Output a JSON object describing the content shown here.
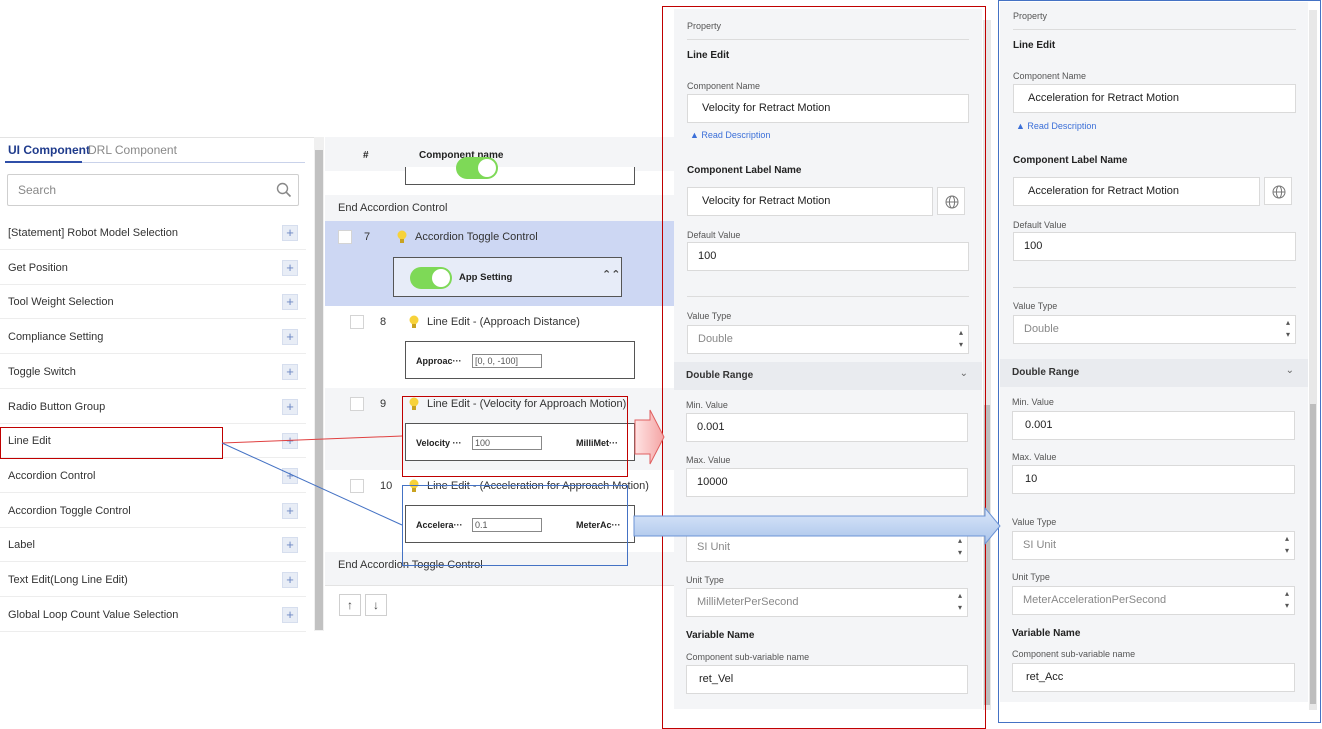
{
  "left_panel": {
    "tabs": {
      "ui": "UI Component",
      "drl": "DRL Component"
    },
    "search_placeholder": "Search",
    "items": [
      "[Statement] Robot Model Selection",
      "Get Position",
      "Tool Weight Selection",
      "Compliance Setting",
      "Toggle Switch",
      "Radio Button Group",
      "Line Edit",
      "Accordion Control",
      "Accordion Toggle Control",
      "Label",
      "Text Edit(Long Line Edit)",
      "Global Loop Count Value Selection"
    ],
    "add_symbol": "+"
  },
  "middle_panel": {
    "headers": {
      "num": "#",
      "name": "Component name"
    },
    "end_accordion": "End Accordion Control",
    "row7": {
      "num": "7",
      "name": "Accordion Toggle Control",
      "preview_label": "App Setting",
      "chevron": "⌃⌃"
    },
    "row8": {
      "num": "8",
      "name": "Line Edit - (Approach Distance)",
      "preview_label": "Approac···",
      "value": "[0, 0, -100]"
    },
    "row9": {
      "num": "9",
      "name": "Line Edit - (Velocity for Approach Motion)",
      "preview_label": "Velocity ···",
      "value": "100",
      "unit": "MilliMet···"
    },
    "row10": {
      "num": "10",
      "name": "Line Edit - (Acceleration for Approach Motion)",
      "preview_label": "Accelera···",
      "value": "0.1",
      "unit": "MeterAc···"
    },
    "end_toggle": "End Accordion Toggle Control",
    "move_up": "↑",
    "move_down": "↓"
  },
  "prop1": {
    "property": "Property",
    "type": "Line Edit",
    "component_name_label": "Component Name",
    "component_name": "Velocity for Retract Motion",
    "read_desc": "▲ Read Description",
    "label_name_label": "Component Label Name",
    "label_name": "Velocity for Retract Motion",
    "default_value_label": "Default Value",
    "default_value": "100",
    "value_type_label": "Value Type",
    "value_type": "Double",
    "double_range": "Double Range",
    "min_label": "Min. Value",
    "min": "0.001",
    "max_label": "Max. Value",
    "max": "10000",
    "unit_sel": "SI Unit",
    "unit_type_label": "Unit Type",
    "unit_type": "MilliMeterPerSecond",
    "var_name_label": "Variable Name",
    "sub_var_label": "Component sub-variable name",
    "sub_var": "ret_Vel"
  },
  "prop2": {
    "property": "Property",
    "type": "Line Edit",
    "component_name_label": "Component Name",
    "component_name": "Acceleration for Retract Motion",
    "read_desc": "▲ Read Description",
    "label_name_label": "Component Label Name",
    "label_name": "Acceleration for Retract Motion",
    "default_value_label": "Default Value",
    "default_value": "100",
    "value_type_label": "Value Type",
    "value_type": "Double",
    "double_range": "Double Range",
    "min_label": "Min. Value",
    "min": "0.001",
    "max_label": "Max. Value",
    "max": "10",
    "value_type2_label": "Value Type",
    "unit_sel": "SI Unit",
    "unit_type_label": "Unit Type",
    "unit_type": "MeterAccelerationPerSecond",
    "var_name_label": "Variable Name",
    "sub_var_label": "Component sub-variable name",
    "sub_var": "ret_Acc"
  },
  "colors": {
    "accent": "#2f4fa8",
    "toggle": "#7ed957",
    "highlight_row": "#cdd7f3",
    "annot_red": "#c00000",
    "annot_blue": "#4472c4"
  }
}
